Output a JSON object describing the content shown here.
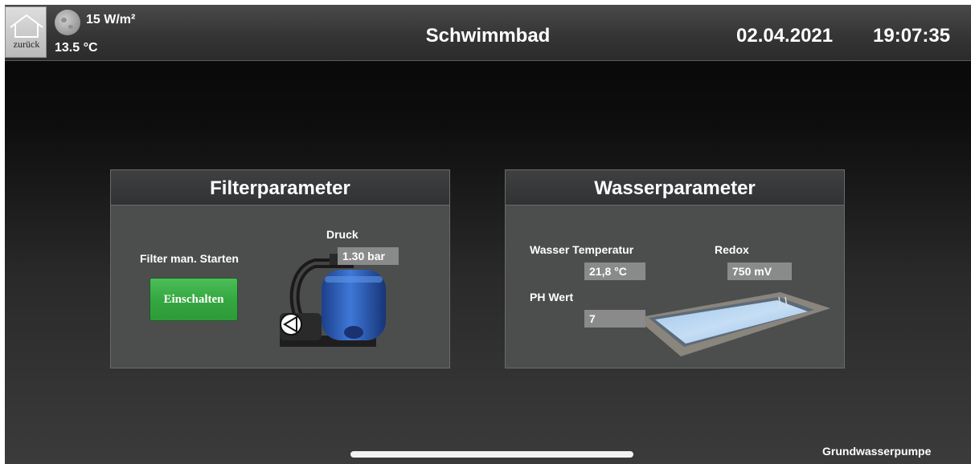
{
  "header": {
    "back_label": "zurück",
    "irradiance": "15 W/m²",
    "temperature": "13.5 °C",
    "title": "Schwimmbad",
    "date": "02.04.2021",
    "time": "19:07:35",
    "weather_icon": "moon-icon"
  },
  "filter_panel": {
    "title": "Filterparameter",
    "manual_start_label": "Filter man. Starten",
    "switch_button_label": "Einschalten",
    "pressure_label": "Druck",
    "pressure_value": "1.30 bar",
    "switch_color": "#3aae45"
  },
  "water_panel": {
    "title": "Wasserparameter",
    "temperature_label": "Wasser Temperatur",
    "temperature_value": "21,8 °C",
    "redox_label": "Redox",
    "redox_value": "750 mV",
    "ph_label": "PH Wert",
    "ph_value": "7"
  },
  "footer": {
    "pump_link": "Grundwasserpumpe"
  }
}
